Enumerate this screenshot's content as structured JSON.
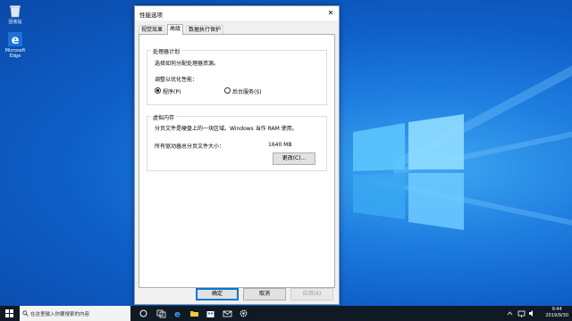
{
  "desktop": {
    "icons": [
      {
        "label": "回收站",
        "icon": "recycle-bin-icon"
      },
      {
        "label": "Microsoft Edge",
        "icon": "edge-icon"
      }
    ]
  },
  "dialog": {
    "title": "性能选项",
    "close_glyph": "✕",
    "tabs": [
      {
        "label": "视觉效果",
        "active": false
      },
      {
        "label": "高级",
        "active": true
      },
      {
        "label": "数据执行保护",
        "active": false
      }
    ],
    "processor": {
      "legend": "处理器计划",
      "description": "选择如何分配处理器资源。",
      "adjust_label": "调整以优化性能：",
      "options": [
        {
          "label": "程序(P)",
          "selected": true
        },
        {
          "label": "后台服务(S)",
          "selected": false
        }
      ]
    },
    "virtual_memory": {
      "legend": "虚拟内存",
      "description": "分页文件是硬盘上的一块区域。Windows 当作 RAM 使用。",
      "total_label": "所有驱动器总分页文件大小：",
      "total_value": "1640 MB",
      "change_button": "更改(C)..."
    },
    "buttons": {
      "ok": "确定",
      "cancel": "取消",
      "apply": "应用(A)"
    }
  },
  "taskbar": {
    "search_placeholder": "在这里输入你要搜索的内容",
    "time": "9:44",
    "date": "2019/9/30"
  },
  "colors": {
    "accent": "#0078d7",
    "desktop": "#1f7fe0",
    "taskbar": "#101a24"
  }
}
